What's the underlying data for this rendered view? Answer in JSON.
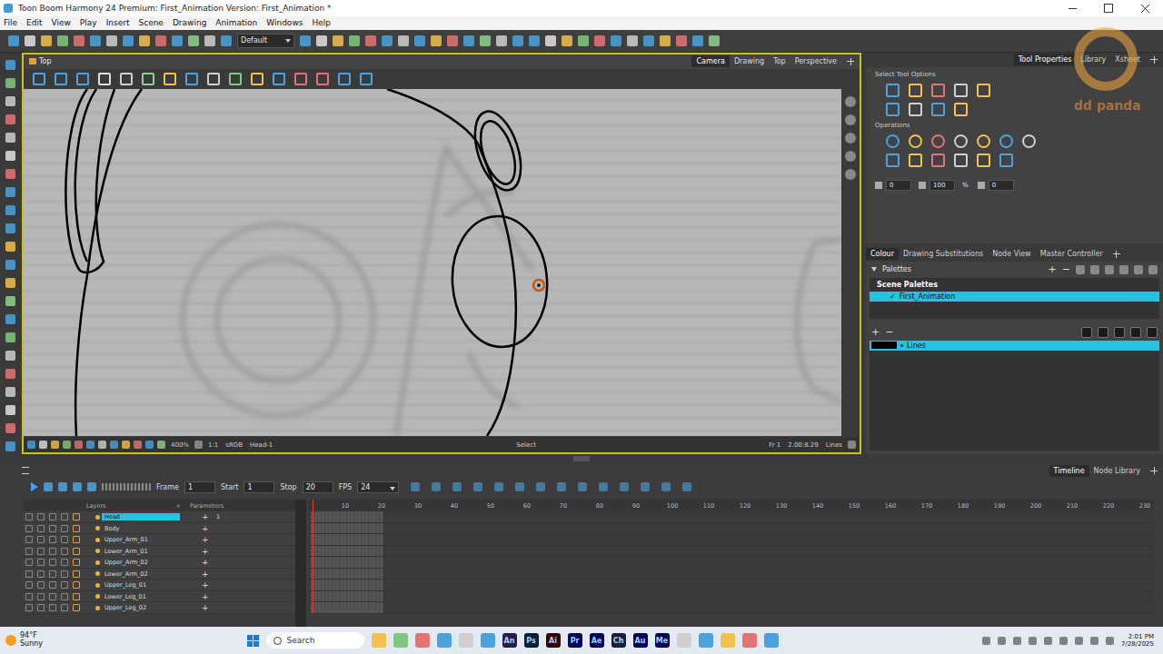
{
  "window": {
    "title": "Toon Boom Harmony 24 Premium: First_Animation Version: First_Animation *"
  },
  "menu": [
    "File",
    "Edit",
    "View",
    "Play",
    "Insert",
    "Scene",
    "Drawing",
    "Animation",
    "Windows",
    "Help"
  ],
  "toolbar": {
    "preset": "Default"
  },
  "viewport": {
    "tab": "Top",
    "views": [
      {
        "label": "Camera",
        "selected": true
      },
      {
        "label": "Drawing",
        "selected": false
      },
      {
        "label": "Top",
        "selected": false
      },
      {
        "label": "Perspective",
        "selected": false
      }
    ],
    "status": {
      "zoom": "400%",
      "ratio": "1:1",
      "color_space": "sRGB",
      "drawing": "Head-1",
      "tool": "Select",
      "frame": "Fr 1",
      "coords": "2.00:8.29",
      "art_layer": "Lines"
    }
  },
  "tool_properties": {
    "tabs": [
      {
        "label": "Tool Properties",
        "selected": true
      },
      {
        "label": "Library",
        "selected": false
      },
      {
        "label": "Xsheet",
        "selected": false
      }
    ],
    "title": "Select Tool Options",
    "operations": "Operations",
    "fields": [
      {
        "value": "0"
      },
      {
        "value": "100",
        "unit": "%"
      },
      {
        "value": "0"
      }
    ]
  },
  "colour": {
    "tabs": [
      {
        "label": "Colour",
        "selected": true
      },
      {
        "label": "Drawing Substitutions",
        "selected": false
      },
      {
        "label": "Node View",
        "selected": false
      },
      {
        "label": "Master Controller",
        "selected": false
      }
    ],
    "palettes_title": "Palettes",
    "scene_palettes": "Scene Palettes",
    "palettes": [
      {
        "name": "First_Animation",
        "selected": true,
        "mark": "✓"
      }
    ],
    "swatches": [
      {
        "name": "Lines",
        "color": "#000000",
        "selected": true
      }
    ],
    "add": "+",
    "remove": "−"
  },
  "timeline": {
    "tabs": [
      {
        "label": "Timeline",
        "selected": true
      },
      {
        "label": "Node Library",
        "selected": false
      }
    ],
    "frame_label": "Frame",
    "frame": "1",
    "start_label": "Start",
    "start": "1",
    "stop_label": "Stop",
    "stop": "20",
    "fps_label": "FPS",
    "fps": "24",
    "layers_header": "Layers",
    "parameters_header": "Parameters",
    "add_glyph": "+",
    "layers": [
      {
        "name": "Head",
        "selected": true,
        "value": "1"
      },
      {
        "name": "Body",
        "selected": false,
        "value": ""
      },
      {
        "name": "Upper_Arm_01",
        "selected": false,
        "value": ""
      },
      {
        "name": "Lower_Arm_01",
        "selected": false,
        "value": ""
      },
      {
        "name": "Upper_Arm_02",
        "selected": false,
        "value": ""
      },
      {
        "name": "Lower_Arm_02",
        "selected": false,
        "value": ""
      },
      {
        "name": "Upper_Leg_01",
        "selected": false,
        "value": ""
      },
      {
        "name": "Lower_Leg_01",
        "selected": false,
        "value": ""
      },
      {
        "name": "Upper_Leg_02",
        "selected": false,
        "value": ""
      }
    ],
    "ruler": [
      "10",
      "20",
      "30",
      "40",
      "50",
      "60",
      "70",
      "80",
      "90",
      "100",
      "110",
      "120",
      "130",
      "140",
      "150",
      "160",
      "170",
      "180",
      "190",
      "200",
      "210",
      "220",
      "230"
    ]
  },
  "taskbar": {
    "temp": "94°F",
    "condition": "Sunny",
    "search": "Search",
    "apps": [
      {
        "label": "An",
        "color": "#2b1a4a"
      },
      {
        "label": "Ps",
        "color": "#001e36"
      },
      {
        "label": "Ai",
        "color": "#330000"
      },
      {
        "label": "Pr",
        "color": "#00005b"
      },
      {
        "label": "Ae",
        "color": "#00005b"
      },
      {
        "label": "Ch",
        "color": "#1b1e3b"
      },
      {
        "label": "Au",
        "color": "#00005b"
      },
      {
        "label": "Me",
        "color": "#00005b"
      }
    ],
    "time": "2:01 PM",
    "date": "7/28/2025"
  },
  "watermark": "dd panda"
}
